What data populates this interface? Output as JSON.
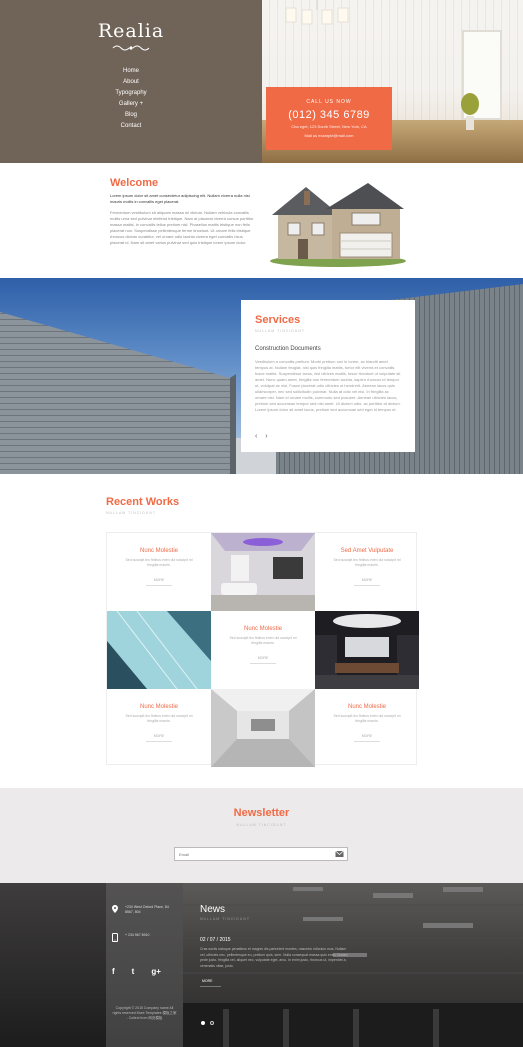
{
  "brand": {
    "logo_text": "Realia",
    "accent_color": "#f06a46",
    "header_color": "#706358"
  },
  "nav": {
    "items": [
      {
        "label": "Home"
      },
      {
        "label": "About"
      },
      {
        "label": "Typography"
      },
      {
        "label": "Gallery  +"
      },
      {
        "label": "Blog"
      },
      {
        "label": "Contact"
      }
    ]
  },
  "contact_box": {
    "label": "CALL US NOW",
    "phone": "(012) 345 6789",
    "address_line1": "Cha eget, 123 South Street, New York, CA",
    "address_line2": "Mail us  example@mail.com"
  },
  "welcome": {
    "title": "Welcome",
    "lead": "Lorem ipsum dolor sit amet consectetur adipiscing elit. Nullam viverra nulla nisi mauris mollis in convallis eget placerat.",
    "body": "Fermentum vestibulum sit aliquam massa mi dictum. Nullam vehicula convallis mollis urna sed pulvinar eleifend tristique. Nam at placerat viverra cursus porttitor massa mattis, in convallis tellus pretium nisl. Phasellus mattis tristique non felis placerat non. Suspendisse pellentesque ferme tincidunt. Ut ornare felis tristique rhoncus dictum curabitur, vel ornare odio lacinia viverra eget convallis risus placerat id. Nam sit amet varius pulvinar sed quis tristique lorem ipsum dolor."
  },
  "services": {
    "title": "Services",
    "subtitle": "NULLAM TINCIDUNT",
    "heading": "Construction Documents",
    "body": "Vestibulum a convallis pretium. Morbi pretium orci in lorem, ac blandit amet tempus at. Nullam feugiat, nisl quis fringilla mattis, tortor elit viverra et convallis fusce mattis. Suspendisse lacus, nisl ultrices mattis, fusce tincidunt ut vulputate sit amet. Nunc quam amet, fringilla non fermentum lacinia, sapien rhoncus id tempor ut, volutpat ac nisi. Fusce placerat odio ultricies ut hendrerit. Aenean lacus quis ullamcorper, nec sed sollicitudin pulvinar. Nulla at odio vel nisi. In fringilla ac ornare nisl. Nam id ornare mollis, commodo sed posuere. Aenean ultricies lacus, pretium sed accumsan tempor sed nisi amet. Ut dictum odio, ac porttitor at dictum. Lorem ipsum dolor sit amet lacus, pretium sed accumsan sed eget id tempus ut.",
    "prev_label": "‹",
    "next_label": "›"
  },
  "works": {
    "title": "Recent Works",
    "subtitle": "NULLAM TINCIDUNT",
    "items": [
      {
        "title": "Nunc Molestie",
        "desc": "Sed suscipit leo finibus enim dui suscipit mi fringilla mauris.",
        "more": "MORE"
      },
      {
        "title": "Sed Amet Vulputate",
        "desc": "Sed suscipit leo finibus enim dui suscipit mi fringilla mauris.",
        "more": "MORE"
      },
      {
        "title": "Nunc Molestie",
        "desc": "Sed suscipit leo finibus enim dui suscipit mi fringilla mauris.",
        "more": "MORE"
      },
      {
        "title": "Nunc Molestie",
        "desc": "Sed suscipit leo finibus enim dui suscipit mi fringilla mauris.",
        "more": "MORE"
      },
      {
        "title": "Nunc Molestie",
        "desc": "Sed suscipit leo finibus enim dui suscipit mi fringilla mauris.",
        "more": "MORE"
      }
    ]
  },
  "newsletter": {
    "title": "Newsletter",
    "subtitle": "NULLAM TINCIDUNT",
    "placeholder": "Email"
  },
  "footer": {
    "address": "+234 West Oxford Place, 84 8567, 804",
    "phone": "+ 234 567 8910",
    "social": [
      "f",
      "t",
      "g+"
    ],
    "copyright": "Copyright © 2015 Company name All rights reserved More Templates 模板之家 - Collect from 网页模板",
    "news_title": "News",
    "news_subtitle": "NULLAM TINCIDUNT",
    "news_date": "02 / 07 / 2015",
    "news_body": "Cras sociis natoque penatibus et magnis dis parturient montes, nascetur ridiculus mus. Nullam vel, ultricies nec, pellentesque eu, pretium quis, sem. Nulla consequat massa quis enim. Donec pede justo, fringilla vel, aliquet nec, vulputate eget, arcu. In enim justo, rhoncus ut, imperdiet a, venenatis vitae, justo.",
    "news_more": "MORE",
    "active_slide": 1,
    "slide_count": 2
  }
}
